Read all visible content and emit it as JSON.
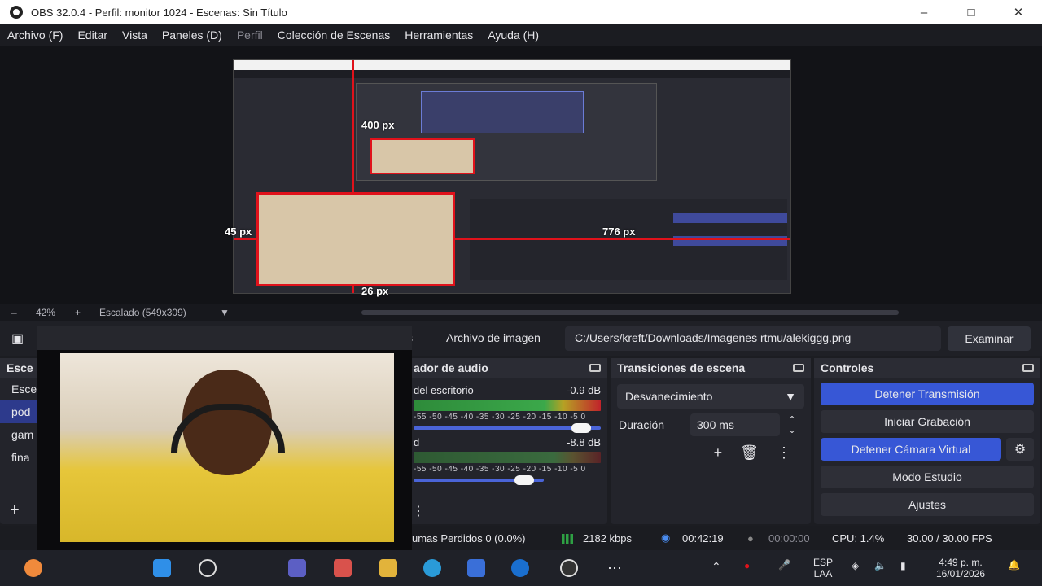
{
  "window": {
    "title": "OBS 32.0.4 - Perfil: monitor 1024 - Escenas: Sin Título"
  },
  "menu": [
    "Archivo (F)",
    "Editar",
    "Vista",
    "Paneles (D)",
    "Perfil",
    "Colección de Escenas",
    "Herramientas",
    "Ayuda (H)"
  ],
  "preview": {
    "measure_top": "400 px",
    "measure_left": "45 px",
    "measure_right": "776 px",
    "measure_bottom": "26 px"
  },
  "zoom": {
    "level": "42%",
    "mode": "Escalado (549x309)"
  },
  "source": {
    "label": "Archivo de imagen",
    "path": "C:/Users/kreft/Downloads/Imagenes rtmu/alekiggg.png",
    "browse": "Examinar",
    "truncated": "s"
  },
  "scenes": {
    "title": "Esce",
    "items": [
      "Esce",
      "pod",
      "gam",
      "fina"
    ]
  },
  "mixer": {
    "title": "ador de audio",
    "ch1_name": "del escritorio",
    "ch1_db": "-0.9 dB",
    "ch2_name": "d",
    "ch2_db": "-8.8 dB",
    "scale": "-55 -50 -45 -40 -35 -30 -25 -20 -15 -10 -5 0"
  },
  "transitions": {
    "title": "Transiciones de escena",
    "selected": "Desvanecimiento",
    "duration_label": "Duración",
    "duration_value": "300 ms"
  },
  "controls": {
    "title": "Controles",
    "stop_stream": "Detener Transmisión",
    "start_record": "Iniciar Grabación",
    "stop_vcam": "Detener Cámara Virtual",
    "studio": "Modo Estudio",
    "settings": "Ajustes"
  },
  "status": {
    "dropped": "umas Perdidos 0 (0.0%)",
    "bitrate": "2182 kbps",
    "stream_time": "00:42:19",
    "rec_time": "00:00:00",
    "cpu": "CPU: 1.4%",
    "fps": "30.00 / 30.00 FPS"
  },
  "taskbar": {
    "lang1": "ESP",
    "lang2": "LAA",
    "time": "4:49 p. m.",
    "date": "16/01/2026"
  },
  "colors": {
    "accent": "#3757d6",
    "red": "#e0121b",
    "bg": "#1c1d22"
  }
}
